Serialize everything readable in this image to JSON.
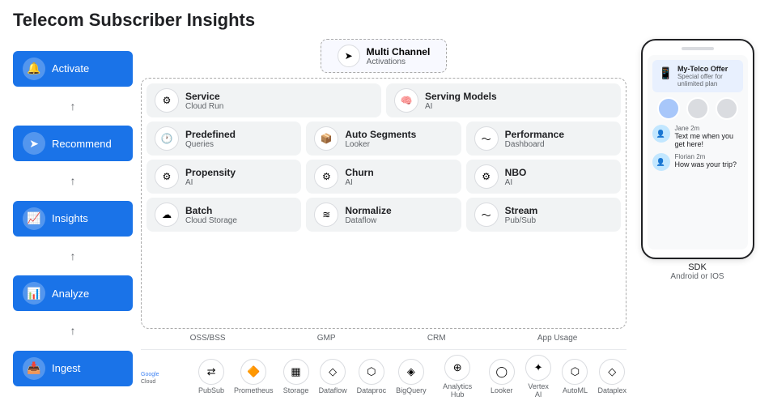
{
  "title": "Telecom Subscriber Insights",
  "sidebar": {
    "items": [
      {
        "label": "Activate",
        "icon": "🔔"
      },
      {
        "label": "Recommend",
        "icon": "➤"
      },
      {
        "label": "Insights",
        "icon": "📈"
      },
      {
        "label": "Analyze",
        "icon": "📊"
      },
      {
        "label": "Ingest",
        "icon": "📥"
      }
    ]
  },
  "diagram": {
    "top": {
      "label": "Multi Channel\nActivations",
      "icon": "➤"
    },
    "service_row": [
      {
        "title": "Service",
        "sub": "Cloud Run",
        "icon": "⚙"
      },
      {
        "title": "Serving Models",
        "sub": "AI",
        "icon": "🧠"
      }
    ],
    "queries_row": [
      {
        "title": "Predefined",
        "sub": "Queries",
        "icon": "🕐"
      },
      {
        "title": "Auto Segments",
        "sub": "Looker",
        "icon": "📦"
      },
      {
        "title": "Performance",
        "sub": "Dashboard",
        "icon": "〜"
      }
    ],
    "ai_row": [
      {
        "title": "Propensity",
        "sub": "AI",
        "icon": "⚙"
      },
      {
        "title": "Churn",
        "sub": "AI",
        "icon": "⚙"
      },
      {
        "title": "NBO",
        "sub": "AI",
        "icon": "⚙"
      }
    ],
    "ingest_row": [
      {
        "title": "Batch",
        "sub": "Cloud Storage",
        "icon": "☁"
      },
      {
        "title": "Normalize",
        "sub": "Dataflow",
        "icon": "≋"
      },
      {
        "title": "Stream",
        "sub": "Pub/Sub",
        "icon": "〜"
      }
    ],
    "source_labels": [
      "OSS/BSS",
      "GMP",
      "CRM",
      "App Usage"
    ]
  },
  "footer": {
    "icons": [
      {
        "label": "PubSub",
        "icon": "⇄"
      },
      {
        "label": "Prometheus",
        "icon": "🔶"
      },
      {
        "label": "Storage",
        "icon": "▦"
      },
      {
        "label": "Dataflow",
        "icon": "◇"
      },
      {
        "label": "Dataproc",
        "icon": "⬡"
      },
      {
        "label": "BigQuery",
        "icon": "◈"
      },
      {
        "label": "Analytics Hub",
        "icon": "⊕"
      },
      {
        "label": "Looker",
        "icon": "◯"
      },
      {
        "label": "Vertex AI",
        "icon": "✦"
      },
      {
        "label": "AutoML",
        "icon": "⬡"
      },
      {
        "label": "Dataplex",
        "icon": "◇"
      }
    ]
  },
  "phone": {
    "offer": {
      "icon": "📱",
      "title": "My-Telco Offer",
      "sub": "Special offer for unlimited plan"
    },
    "messages": [
      {
        "name": "Jane",
        "time": "2m",
        "text": "Text me when you get here!"
      },
      {
        "name": "Florian",
        "time": "2m",
        "text": "How was your trip?"
      }
    ],
    "sdk_label": "SDK",
    "platform_label": "Android or IOS"
  }
}
